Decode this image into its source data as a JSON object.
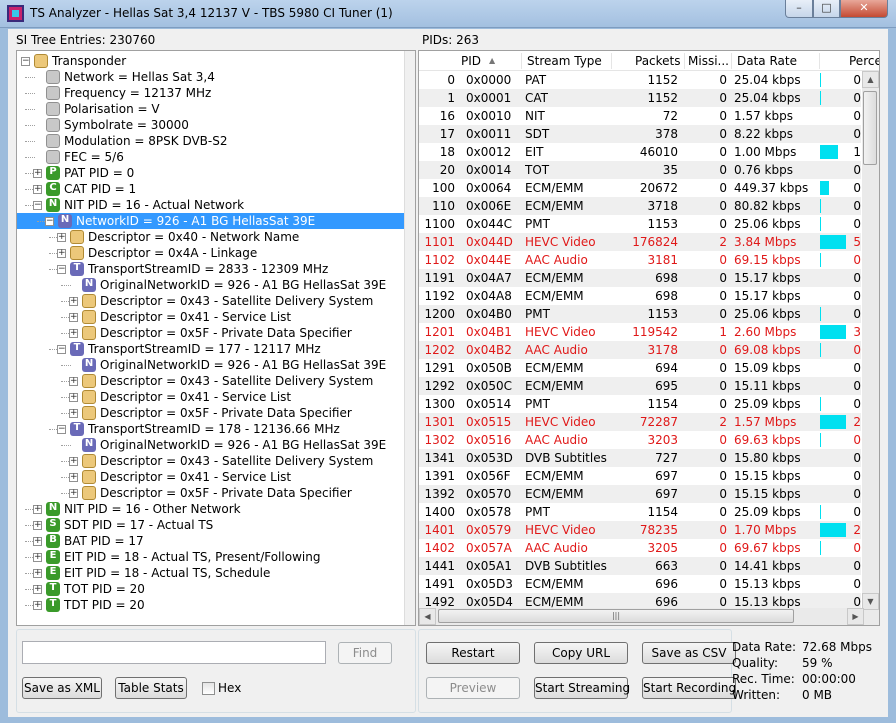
{
  "window": {
    "title": "TS Analyzer - Hellas Sat 3,4 12137 V - TBS 5980 CI Tuner (1)"
  },
  "left": {
    "header": "SI Tree Entries: 230760",
    "tree": [
      {
        "level": 0,
        "exp": "-",
        "icon": "folder",
        "label": "Transponder"
      },
      {
        "level": 1,
        "exp": "",
        "icon": "leaf",
        "label": "Network = Hellas Sat 3,4"
      },
      {
        "level": 1,
        "exp": "",
        "icon": "leaf",
        "label": "Frequency = 12137 MHz"
      },
      {
        "level": 1,
        "exp": "",
        "icon": "leaf",
        "label": "Polarisation = V"
      },
      {
        "level": 1,
        "exp": "",
        "icon": "leaf",
        "label": "Symbolrate = 30000"
      },
      {
        "level": 1,
        "exp": "",
        "icon": "leaf",
        "label": "Modulation = 8PSK DVB-S2"
      },
      {
        "level": 1,
        "exp": "",
        "icon": "leaf",
        "label": "FEC = 5/6"
      },
      {
        "level": 1,
        "exp": "+",
        "icon": "letter",
        "letter": "P",
        "color": "#3a9a2a",
        "label": "PAT PID = 0"
      },
      {
        "level": 1,
        "exp": "+",
        "icon": "letter",
        "letter": "C",
        "color": "#3a9a2a",
        "label": "CAT PID = 1"
      },
      {
        "level": 1,
        "exp": "-",
        "icon": "letter",
        "letter": "N",
        "color": "#3a9a2a",
        "label": "NIT PID = 16 - Actual Network"
      },
      {
        "level": 2,
        "exp": "-",
        "icon": "letter",
        "letter": "N",
        "color": "#6a6ab8",
        "label": "NetworkID = 926 - A1 BG HellasSat 39E",
        "selected": true
      },
      {
        "level": 3,
        "exp": "+",
        "icon": "folder",
        "label": "Descriptor = 0x40 - Network Name"
      },
      {
        "level": 3,
        "exp": "+",
        "icon": "folder",
        "label": "Descriptor = 0x4A - Linkage"
      },
      {
        "level": 3,
        "exp": "-",
        "icon": "letter",
        "letter": "T",
        "color": "#6a6ab8",
        "label": "TransportStreamID = 2833 - 12309 MHz"
      },
      {
        "level": 4,
        "exp": "",
        "icon": "letter",
        "letter": "N",
        "color": "#6a6ab8",
        "label": "OriginalNetworkID = 926 - A1 BG HellasSat 39E"
      },
      {
        "level": 4,
        "exp": "+",
        "icon": "folder",
        "label": "Descriptor = 0x43 - Satellite Delivery System"
      },
      {
        "level": 4,
        "exp": "+",
        "icon": "folder",
        "label": "Descriptor = 0x41 - Service List"
      },
      {
        "level": 4,
        "exp": "+",
        "icon": "folder",
        "label": "Descriptor = 0x5F - Private Data Specifier"
      },
      {
        "level": 3,
        "exp": "-",
        "icon": "letter",
        "letter": "T",
        "color": "#6a6ab8",
        "label": "TransportStreamID = 177 - 12117 MHz"
      },
      {
        "level": 4,
        "exp": "",
        "icon": "letter",
        "letter": "N",
        "color": "#6a6ab8",
        "label": "OriginalNetworkID = 926 - A1 BG HellasSat 39E"
      },
      {
        "level": 4,
        "exp": "+",
        "icon": "folder",
        "label": "Descriptor = 0x43 - Satellite Delivery System"
      },
      {
        "level": 4,
        "exp": "+",
        "icon": "folder",
        "label": "Descriptor = 0x41 - Service List"
      },
      {
        "level": 4,
        "exp": "+",
        "icon": "folder",
        "label": "Descriptor = 0x5F - Private Data Specifier"
      },
      {
        "level": 3,
        "exp": "-",
        "icon": "letter",
        "letter": "T",
        "color": "#6a6ab8",
        "label": "TransportStreamID = 178 - 12136.66 MHz"
      },
      {
        "level": 4,
        "exp": "",
        "icon": "letter",
        "letter": "N",
        "color": "#6a6ab8",
        "label": "OriginalNetworkID = 926 - A1 BG HellasSat 39E"
      },
      {
        "level": 4,
        "exp": "+",
        "icon": "folder",
        "label": "Descriptor = 0x43 - Satellite Delivery System"
      },
      {
        "level": 4,
        "exp": "+",
        "icon": "folder",
        "label": "Descriptor = 0x41 - Service List"
      },
      {
        "level": 4,
        "exp": "+",
        "icon": "folder",
        "label": "Descriptor = 0x5F - Private Data Specifier"
      },
      {
        "level": 1,
        "exp": "+",
        "icon": "letter",
        "letter": "N",
        "color": "#3a9a2a",
        "label": "NIT PID = 16 - Other Network"
      },
      {
        "level": 1,
        "exp": "+",
        "icon": "letter",
        "letter": "S",
        "color": "#3a9a2a",
        "label": "SDT PID = 17 - Actual TS"
      },
      {
        "level": 1,
        "exp": "+",
        "icon": "letter",
        "letter": "B",
        "color": "#3a9a2a",
        "label": "BAT PID = 17"
      },
      {
        "level": 1,
        "exp": "+",
        "icon": "letter",
        "letter": "E",
        "color": "#3a9a2a",
        "label": "EIT PID = 18 - Actual TS, Present/Following"
      },
      {
        "level": 1,
        "exp": "+",
        "icon": "letter",
        "letter": "E",
        "color": "#3a9a2a",
        "label": "EIT PID = 18 - Actual TS, Schedule"
      },
      {
        "level": 1,
        "exp": "+",
        "icon": "letter",
        "letter": "T",
        "color": "#3a9a2a",
        "label": "TOT PID = 20"
      },
      {
        "level": 1,
        "exp": "+",
        "icon": "letter",
        "letter": "T",
        "color": "#3a9a2a",
        "label": "TDT PID = 20"
      }
    ],
    "search_value": "",
    "find_label": "Find",
    "save_xml_label": "Save as XML",
    "table_stats_label": "Table Stats",
    "hex_label": "Hex"
  },
  "right": {
    "header": "PIDs: 263",
    "columns": [
      "PID",
      "Stream Type",
      "Packets",
      "Missi...",
      "Data Rate",
      "Perce"
    ],
    "rows": [
      {
        "pid": "0",
        "hex": "0x0000",
        "type": "PAT",
        "packets": "1152",
        "miss": "0",
        "rate": "25.04 kbps",
        "pct": "0",
        "bar": 0.005
      },
      {
        "pid": "1",
        "hex": "0x0001",
        "type": "CAT",
        "packets": "1152",
        "miss": "0",
        "rate": "25.04 kbps",
        "pct": "0",
        "bar": 0.005
      },
      {
        "pid": "16",
        "hex": "0x0010",
        "type": "NIT",
        "packets": "72",
        "miss": "0",
        "rate": "1.57 kbps",
        "pct": "0",
        "bar": 0
      },
      {
        "pid": "17",
        "hex": "0x0011",
        "type": "SDT",
        "packets": "378",
        "miss": "0",
        "rate": "8.22 kbps",
        "pct": "0",
        "bar": 0
      },
      {
        "pid": "18",
        "hex": "0x0012",
        "type": "EIT",
        "packets": "46010",
        "miss": "0",
        "rate": "1.00 Mbps",
        "pct": "1",
        "bar": 0.7
      },
      {
        "pid": "20",
        "hex": "0x0014",
        "type": "TOT",
        "packets": "35",
        "miss": "0",
        "rate": "0.76 kbps",
        "pct": "0",
        "bar": 0
      },
      {
        "pid": "100",
        "hex": "0x0064",
        "type": "ECM/EMM",
        "packets": "20672",
        "miss": "0",
        "rate": "449.37 kbps",
        "pct": "0",
        "bar": 0.35
      },
      {
        "pid": "110",
        "hex": "0x006E",
        "type": "ECM/EMM",
        "packets": "3718",
        "miss": "0",
        "rate": "80.82 kbps",
        "pct": "0",
        "bar": 0.05
      },
      {
        "pid": "1100",
        "hex": "0x044C",
        "type": "PMT",
        "packets": "1153",
        "miss": "0",
        "rate": "25.06 kbps",
        "pct": "0",
        "bar": 0.005
      },
      {
        "pid": "1101",
        "hex": "0x044D",
        "type": "HEVC Video",
        "packets": "176824",
        "miss": "2",
        "rate": "3.84 Mbps",
        "pct": "5",
        "bar": 1,
        "red": true
      },
      {
        "pid": "1102",
        "hex": "0x044E",
        "type": "AAC Audio",
        "packets": "3181",
        "miss": "0",
        "rate": "69.15 kbps",
        "pct": "0",
        "bar": 0.05,
        "red": true
      },
      {
        "pid": "1191",
        "hex": "0x04A7",
        "type": "ECM/EMM",
        "packets": "698",
        "miss": "0",
        "rate": "15.17 kbps",
        "pct": "0",
        "bar": 0
      },
      {
        "pid": "1192",
        "hex": "0x04A8",
        "type": "ECM/EMM",
        "packets": "698",
        "miss": "0",
        "rate": "15.17 kbps",
        "pct": "0",
        "bar": 0
      },
      {
        "pid": "1200",
        "hex": "0x04B0",
        "type": "PMT",
        "packets": "1153",
        "miss": "0",
        "rate": "25.06 kbps",
        "pct": "0",
        "bar": 0.005
      },
      {
        "pid": "1201",
        "hex": "0x04B1",
        "type": "HEVC Video",
        "packets": "119542",
        "miss": "1",
        "rate": "2.60 Mbps",
        "pct": "3",
        "bar": 1,
        "red": true
      },
      {
        "pid": "1202",
        "hex": "0x04B2",
        "type": "AAC Audio",
        "packets": "3178",
        "miss": "0",
        "rate": "69.08 kbps",
        "pct": "0",
        "bar": 0.05,
        "red": true
      },
      {
        "pid": "1291",
        "hex": "0x050B",
        "type": "ECM/EMM",
        "packets": "694",
        "miss": "0",
        "rate": "15.09 kbps",
        "pct": "0",
        "bar": 0
      },
      {
        "pid": "1292",
        "hex": "0x050C",
        "type": "ECM/EMM",
        "packets": "695",
        "miss": "0",
        "rate": "15.11 kbps",
        "pct": "0",
        "bar": 0
      },
      {
        "pid": "1300",
        "hex": "0x0514",
        "type": "PMT",
        "packets": "1154",
        "miss": "0",
        "rate": "25.09 kbps",
        "pct": "0",
        "bar": 0.005
      },
      {
        "pid": "1301",
        "hex": "0x0515",
        "type": "HEVC Video",
        "packets": "72287",
        "miss": "2",
        "rate": "1.57 Mbps",
        "pct": "2",
        "bar": 1,
        "red": true
      },
      {
        "pid": "1302",
        "hex": "0x0516",
        "type": "AAC Audio",
        "packets": "3203",
        "miss": "0",
        "rate": "69.63 kbps",
        "pct": "0",
        "bar": 0.05,
        "red": true
      },
      {
        "pid": "1341",
        "hex": "0x053D",
        "type": "DVB Subtitles",
        "packets": "727",
        "miss": "0",
        "rate": "15.80 kbps",
        "pct": "0",
        "bar": 0
      },
      {
        "pid": "1391",
        "hex": "0x056F",
        "type": "ECM/EMM",
        "packets": "697",
        "miss": "0",
        "rate": "15.15 kbps",
        "pct": "0",
        "bar": 0
      },
      {
        "pid": "1392",
        "hex": "0x0570",
        "type": "ECM/EMM",
        "packets": "697",
        "miss": "0",
        "rate": "15.15 kbps",
        "pct": "0",
        "bar": 0
      },
      {
        "pid": "1400",
        "hex": "0x0578",
        "type": "PMT",
        "packets": "1154",
        "miss": "0",
        "rate": "25.09 kbps",
        "pct": "0",
        "bar": 0.005
      },
      {
        "pid": "1401",
        "hex": "0x0579",
        "type": "HEVC Video",
        "packets": "78235",
        "miss": "0",
        "rate": "1.70 Mbps",
        "pct": "2",
        "bar": 1,
        "red": true
      },
      {
        "pid": "1402",
        "hex": "0x057A",
        "type": "AAC Audio",
        "packets": "3205",
        "miss": "0",
        "rate": "69.67 kbps",
        "pct": "0",
        "bar": 0.05,
        "red": true
      },
      {
        "pid": "1441",
        "hex": "0x05A1",
        "type": "DVB Subtitles",
        "packets": "663",
        "miss": "0",
        "rate": "14.41 kbps",
        "pct": "0",
        "bar": 0
      },
      {
        "pid": "1491",
        "hex": "0x05D3",
        "type": "ECM/EMM",
        "packets": "696",
        "miss": "0",
        "rate": "15.13 kbps",
        "pct": "0",
        "bar": 0
      },
      {
        "pid": "1492",
        "hex": "0x05D4",
        "type": "ECM/EMM",
        "packets": "696",
        "miss": "0",
        "rate": "15.13 kbps",
        "pct": "0",
        "bar": 0
      }
    ],
    "buttons": {
      "restart": "Restart",
      "copy_url": "Copy URL",
      "save_csv": "Save as CSV",
      "preview": "Preview",
      "start_streaming": "Start Streaming",
      "start_recording": "Start Recording"
    },
    "stats": {
      "data_rate_label": "Data Rate:",
      "data_rate_value": "72.68 Mbps",
      "quality_label": "Quality:",
      "quality_value": "59 %",
      "rec_time_label": "Rec. Time:",
      "rec_time_value": "00:00:00",
      "written_label": "Written:",
      "written_value": "0 MB"
    }
  },
  "colors": {
    "selection": "#3399ff",
    "rate_bar": "#00e0f0",
    "red_row": "#e01818",
    "icon_green": "#3a9a2a",
    "icon_purple": "#6a6ab8"
  }
}
